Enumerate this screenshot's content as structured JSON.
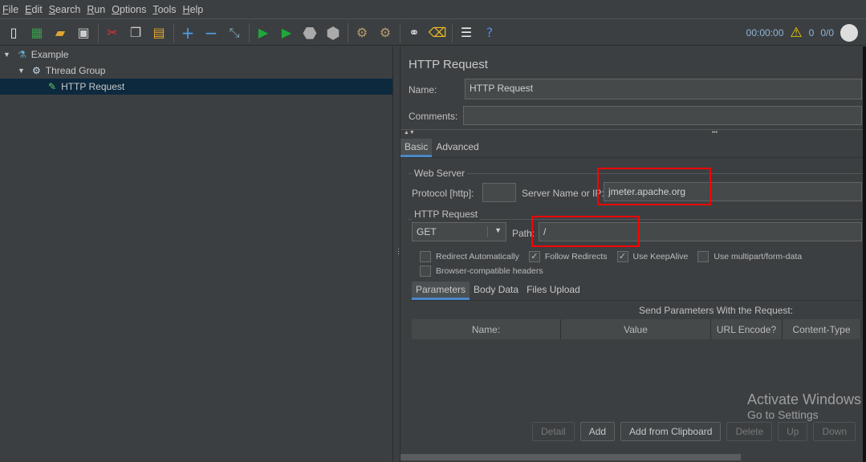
{
  "menu": [
    "File",
    "Edit",
    "Search",
    "Run",
    "Options",
    "Tools",
    "Help"
  ],
  "toolbar": {
    "icons": [
      "new-icon",
      "templates-icon",
      "open-icon",
      "save-icon",
      "cut-icon",
      "copy-icon",
      "paste-icon",
      "expand-icon",
      "collapse-icon",
      "toggle-icon",
      "start-icon",
      "start-no-pause-icon",
      "stop-icon",
      "shutdown-icon",
      "clear-icon",
      "clear-all-icon",
      "search-icon",
      "reset-search-icon",
      "function-helper-icon",
      "help-icon"
    ]
  },
  "status": {
    "timer": "00:00:00",
    "warnings": "0",
    "threads": "0/0"
  },
  "tree": [
    {
      "label": "Example"
    },
    {
      "label": "Thread Group"
    },
    {
      "label": "HTTP Request"
    }
  ],
  "panel": {
    "title": "HTTP Request",
    "name_label": "Name:",
    "name_value": "HTTP Request",
    "comments_label": "Comments:",
    "comments_value": "",
    "tabs": [
      "Basic",
      "Advanced"
    ],
    "web_server": {
      "legend": "Web Server",
      "protocol_label": "Protocol [http]:",
      "protocol_value": "",
      "server_label": "Server Name or IP:",
      "server_value": "jmeter.apache.org"
    },
    "http_request": {
      "legend": "HTTP Request",
      "method": "GET",
      "path_label": "Path:",
      "path_value": "/"
    },
    "checkboxes": [
      {
        "label": "Redirect Automatically",
        "checked": false
      },
      {
        "label": "Follow Redirects",
        "checked": true
      },
      {
        "label": "Use KeepAlive",
        "checked": true
      },
      {
        "label": "Use multipart/form-data",
        "checked": false
      },
      {
        "label": "Browser-compatible headers",
        "checked": false
      }
    ],
    "param_tabs": [
      "Parameters",
      "Body Data",
      "Files Upload"
    ],
    "send_params": "Send Parameters With the Request:",
    "columns": [
      "Name:",
      "Value",
      "URL Encode?",
      "Content-Type"
    ],
    "buttons": [
      "Detail",
      "Add",
      "Add from Clipboard",
      "Delete",
      "Up",
      "Down"
    ]
  },
  "watermark": {
    "line1": "Activate Windows",
    "line2": "Go to Settings"
  }
}
